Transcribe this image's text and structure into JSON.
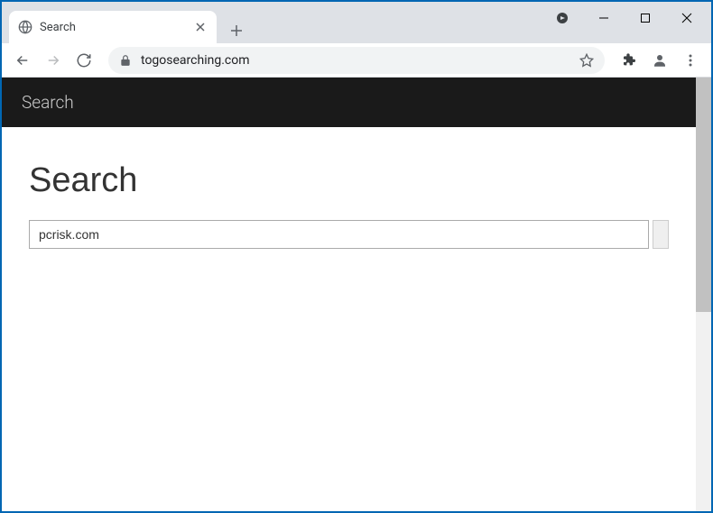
{
  "window": {
    "tab_title": "Search",
    "url": "togosearching.com"
  },
  "page": {
    "header_text": "Search",
    "heading": "Search",
    "search_value": "pcrisk.com"
  }
}
